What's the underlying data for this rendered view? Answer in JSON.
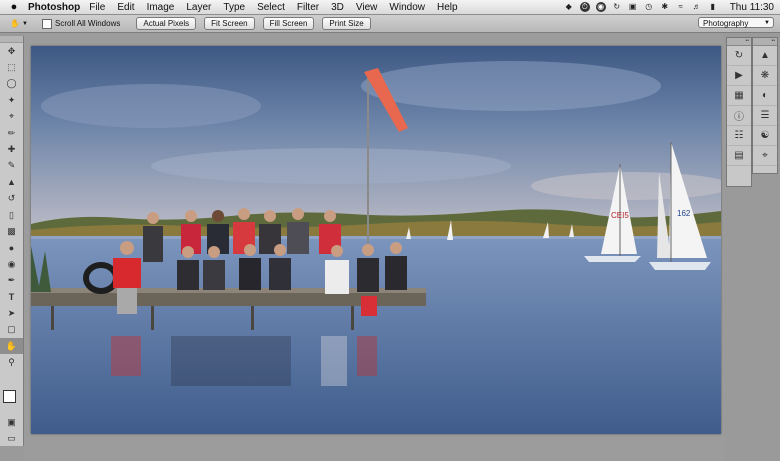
{
  "menubar": {
    "apple": "",
    "app_name": "Photoshop",
    "items": [
      "File",
      "Edit",
      "Image",
      "Layer",
      "Type",
      "Select",
      "Filter",
      "3D",
      "View",
      "Window",
      "Help"
    ],
    "clock": "Thu 11:30"
  },
  "options": {
    "scroll_all_windows": "Scroll All Windows",
    "actual_pixels": "Actual Pixels",
    "fit_screen": "Fit Screen",
    "fill_screen": "Fill Screen",
    "print_size": "Print Size",
    "workspace": "Photography"
  },
  "tools": [
    "move-tool",
    "marquee-tool",
    "lasso-tool",
    "quick-select-tool",
    "crop-tool",
    "eyedropper-tool",
    "healing-brush-tool",
    "brush-tool",
    "clone-stamp-tool",
    "history-brush-tool",
    "eraser-tool",
    "gradient-tool",
    "blur-tool",
    "dodge-tool",
    "pen-tool",
    "type-tool",
    "path-select-tool",
    "shape-tool",
    "hand-tool",
    "zoom-tool"
  ],
  "photo": {
    "sail_numbers": [
      "CEI5",
      "162"
    ]
  },
  "colors": {
    "menubar": "#e6e6e6",
    "sky_top": "#3d5884",
    "water": "#4c6a99",
    "windsock": "#e8684f"
  }
}
